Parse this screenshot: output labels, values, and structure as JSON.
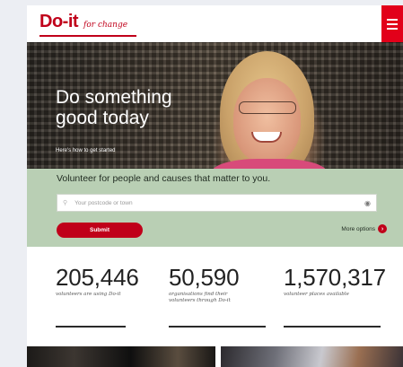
{
  "header": {
    "logo_text": "Do-it",
    "logo_tagline": "for change",
    "menu_icon": "hamburger-menu-icon"
  },
  "hero": {
    "title_line1": "Do something",
    "title_line2": "good today",
    "subtitle": "Here's how to get started"
  },
  "search": {
    "heading": "Volunteer for people and causes that matter to you.",
    "placeholder": "Your postcode or town",
    "submit_label": "Submit",
    "more_options_label": "More options"
  },
  "stats": [
    {
      "number": "205,446",
      "caption": "volunteers are using Do-it"
    },
    {
      "number": "50,590",
      "caption_line1": "organisations find their",
      "caption_line2": "volunteers through Do-it"
    },
    {
      "number": "1,570,317",
      "caption": "volunteer places available"
    }
  ],
  "colors": {
    "brand_red": "#c0001a",
    "menu_red": "#e2001a",
    "panel_green": "#b9cfb4"
  }
}
